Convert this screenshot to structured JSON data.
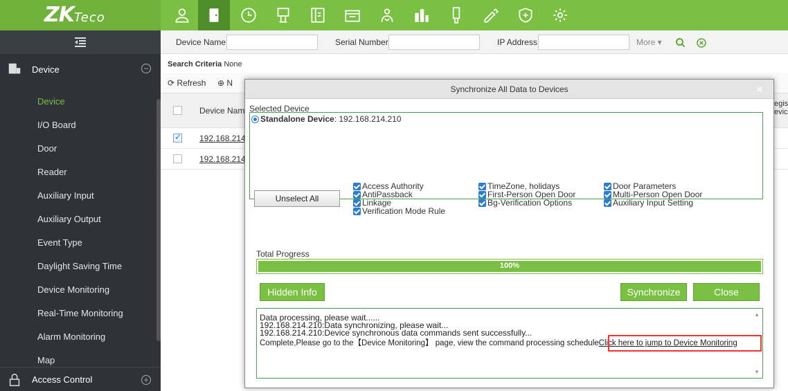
{
  "brand": {
    "logo_main": "ZK",
    "logo_sub": "Teco"
  },
  "nav_icons": [
    "person-icon",
    "door-icon",
    "clock-icon",
    "elevator-icon",
    "visitor-icon",
    "parking-icon",
    "patrol-icon",
    "building-icon",
    "usb-icon",
    "pen-icon",
    "shield-plus-icon",
    "gear-icon"
  ],
  "sidebar": {
    "group_device": "Device",
    "group_access": "Access Control",
    "items": [
      "Device",
      "I/O Board",
      "Door",
      "Reader",
      "Auxiliary Input",
      "Auxiliary Output",
      "Event Type",
      "Daylight Saving Time",
      "Device Monitoring",
      "Real-Time Monitoring",
      "Alarm Monitoring",
      "Map"
    ]
  },
  "search": {
    "device_name_label": "Device Name",
    "serial_label": "Serial Number",
    "ip_label": "IP Address",
    "more_label": "More"
  },
  "criteria": {
    "label": "Search Criteria",
    "value": "None"
  },
  "toolbar": {
    "refresh": "Refresh",
    "new_partial": "N"
  },
  "grid": {
    "col_device_name": "Device Name",
    "col_right_partial_1": "egis",
    "col_right_partial_2": "evic",
    "rows": [
      "192.168.214.",
      "192.168.214."
    ]
  },
  "modal": {
    "title": "Synchronize All Data to Devices",
    "close_symbol": "×",
    "selected_label": "Selected Device",
    "device_name": "Standalone Device",
    "device_ip": " : 192.168.214.210",
    "unselect_all": "Unselect All",
    "options": [
      "Access Authority",
      "AntiPassback",
      "Linkage",
      "Verification Mode Rule",
      "TimeZone, holidays",
      "First-Person Open Door",
      "Bg-Verification Options",
      "Door Parameters",
      "Multi-Person Open Door",
      "Auxiliary Input Setting"
    ],
    "progress_label": "Total Progress",
    "progress_text": "100%",
    "progress_value": 1.0,
    "hidden_info": "Hidden Info",
    "synchronize": "Synchronize",
    "close": "Close",
    "log": {
      "line1": "Data processing, please wait......",
      "line2": "192.168.214.210:Data synchronizing, please wait...",
      "line3": "192.168.214.210:Device synchronous data commands sent successfully...",
      "line4": "Complete,Please go to the【Device Monitoring】 page, view the command processing schedule",
      "link": "Click here to jump to Device Monitoring"
    }
  },
  "colors": {
    "accent": "#7ac143",
    "sidebar_bg": "#2f3238",
    "highlight": "#ee3333"
  }
}
